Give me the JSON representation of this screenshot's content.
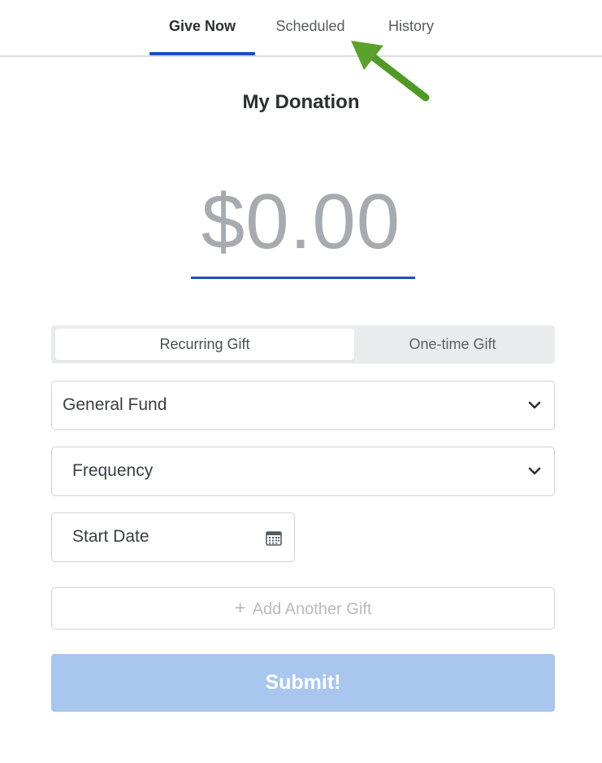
{
  "tabs": [
    {
      "label": "Give Now",
      "active": true
    },
    {
      "label": "Scheduled",
      "active": false
    },
    {
      "label": "History",
      "active": false
    }
  ],
  "annotation": {
    "icon": "arrow-pointer-icon",
    "color": "#5aa22b"
  },
  "title": "My Donation",
  "amount": "$0.00",
  "gift_type": {
    "options": [
      "Recurring Gift",
      "One-time Gift"
    ],
    "selected": "Recurring Gift"
  },
  "fund_select": {
    "value": "General Fund",
    "icon": "chevron-down-icon"
  },
  "frequency_select": {
    "value": "Frequency",
    "icon": "chevron-down-icon"
  },
  "start_date": {
    "placeholder": "Start Date",
    "icon": "calendar-icon"
  },
  "add_gift": {
    "label": "Add Another Gift",
    "icon": "plus-icon"
  },
  "submit": {
    "label": "Submit!"
  },
  "colors": {
    "accent": "#1b4fc2",
    "submit_bg": "#a9c6ee",
    "amount_text": "#a7abaf",
    "border": "#cfd2d5"
  }
}
